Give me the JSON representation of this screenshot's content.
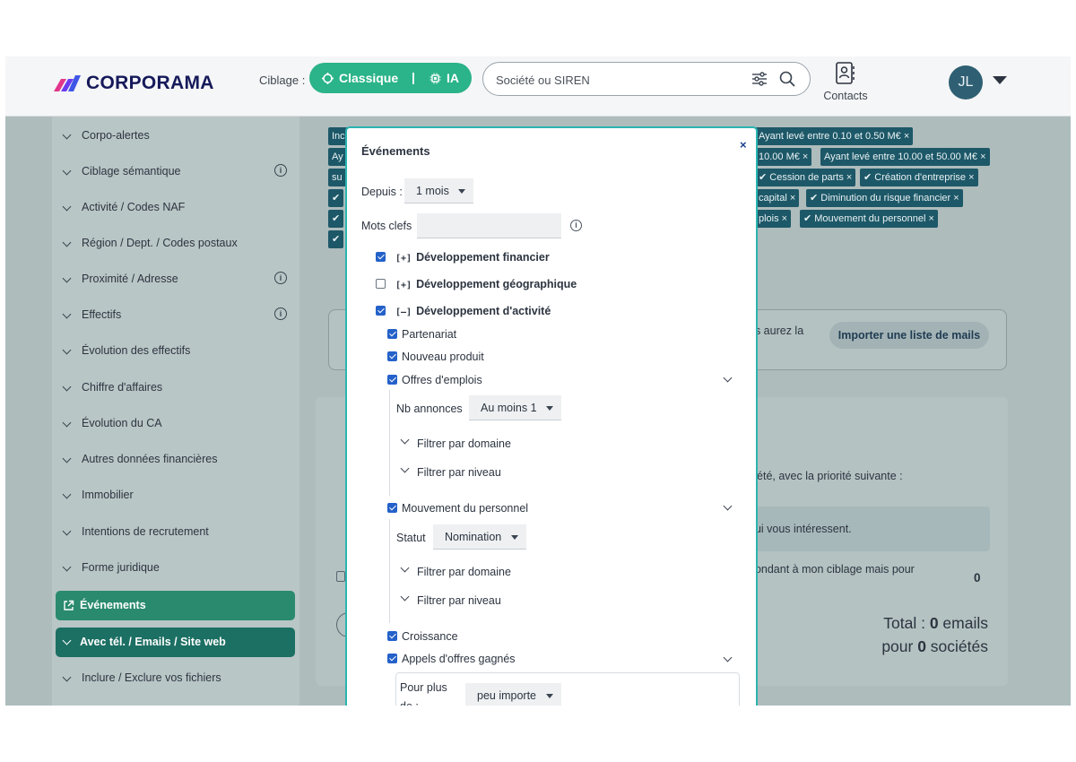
{
  "header": {
    "brand": "CORPORAMA",
    "ciblage_label": "Ciblage :",
    "mode_classique": "Classique",
    "mode_separator": "|",
    "mode_ia": "IA",
    "search_placeholder": "Société ou SIREN",
    "contacts_label": "Contacts",
    "avatar_initials": "JL",
    "brand_color": "#15195a",
    "accent_color": "#2bb389"
  },
  "sidebar": {
    "items": [
      {
        "label": "Corpo-alertes",
        "info": false
      },
      {
        "label": "Ciblage sémantique",
        "info": true
      },
      {
        "label": "Activité / Codes NAF",
        "info": false
      },
      {
        "label": "Région / Dept. / Codes postaux",
        "info": false
      },
      {
        "label": "Proximité / Adresse",
        "info": true
      },
      {
        "label": "Effectifs",
        "info": true
      },
      {
        "label": "Évolution des effectifs",
        "info": false
      },
      {
        "label": "Chiffre d'affaires",
        "info": false
      },
      {
        "label": "Évolution du CA",
        "info": false
      },
      {
        "label": "Autres données financières",
        "info": false
      },
      {
        "label": "Immobilier",
        "info": false
      },
      {
        "label": "Intentions de recrutement",
        "info": false
      },
      {
        "label": "Forme juridique",
        "info": false
      }
    ],
    "active_evenements": "Événements",
    "active_contacts": "Avec tél. / Emails / Site web",
    "last_item": "Inclure / Exclure vos fichiers"
  },
  "tags": {
    "row1_left": "Inc",
    "row1_right": "Ayant levé entre 0.10 et 0.50 M€ ×",
    "row2_left": "Ay",
    "row2_mid": "10.00 M€ ×",
    "row2_right": "Ayant levé entre 10.00 et 50.00 M€ ×",
    "row3_left": "su",
    "row3_mid": "✔ Cession de parts ×",
    "row3_right": "✔ Création d'entreprise ×",
    "row4_left": "✔",
    "row4_mid": "capital ×",
    "row4_right": "✔ Diminution du risque financier ×",
    "row5_left": "✔",
    "row5_mid": "plois ×",
    "row5_right": "✔ Mouvement du personnel ×",
    "row6_left": "✔"
  },
  "background": {
    "panel_text": "us aurez la",
    "import_button": "Importer une liste de mails",
    "priority_text": "ciété, avec la priorité suivante :",
    "interest_text": "qui vous intéressent.",
    "matching_text": "pondant à mon ciblage mais pour",
    "matching_count": "0",
    "total_line1_prefix": "Total : ",
    "total_emails_count": "0",
    "total_line1_suffix": " emails",
    "total_line2_prefix": "pour ",
    "total_companies_count": "0",
    "total_line2_suffix": " sociétés"
  },
  "modal": {
    "title": "Événements",
    "close": "×",
    "depuis_label": "Depuis :",
    "depuis_value": "1 mois",
    "mots_clefs_label": "Mots clefs",
    "mots_clefs_value": "",
    "groups": [
      {
        "toggle": "[+]",
        "label": "Développement financier",
        "checked": true
      },
      {
        "toggle": "[+]",
        "label": "Développement géographique",
        "checked": false
      },
      {
        "toggle": "[–]",
        "label": "Développement d'activité",
        "checked": true
      }
    ],
    "sub": {
      "partenariat": "Partenariat",
      "nouveau_produit": "Nouveau produit",
      "offres_emplois": "Offres d'emplois",
      "nb_annonces_label": "Nb annonces",
      "nb_annonces_value": "Au moins 1",
      "filtrer_domaine": "Filtrer par domaine",
      "filtrer_niveau": "Filtrer par niveau",
      "mouvement": "Mouvement du personnel",
      "statut_label": "Statut",
      "statut_value": "Nomination",
      "croissance": "Croissance",
      "appels": "Appels d'offres gagnés",
      "pour_plus_label": "Pour plus de :",
      "pour_plus_value": "peu importe"
    }
  }
}
